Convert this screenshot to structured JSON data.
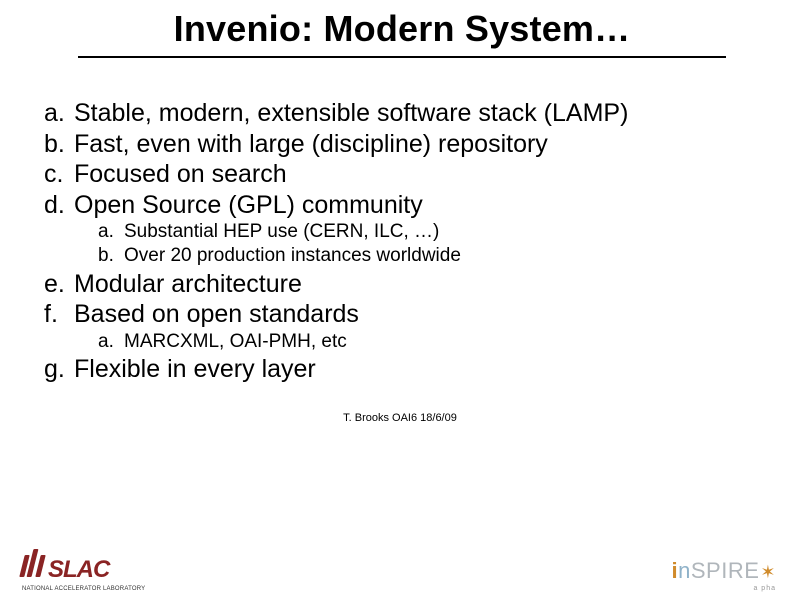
{
  "title": "Invenio: Modern System…",
  "items": {
    "a": {
      "m": "a.",
      "t": "Stable, modern, extensible software stack (LAMP)"
    },
    "b": {
      "m": "b.",
      "t": "Fast, even with large (discipline) repository"
    },
    "c": {
      "m": "c.",
      "t": "Focused on search"
    },
    "d": {
      "m": "d.",
      "t": "Open Source (GPL) community"
    },
    "d_sub": {
      "a": {
        "m": "a.",
        "t": "Substantial HEP use (CERN, ILC, …)"
      },
      "b": {
        "m": "b.",
        "t": "Over 20 production instances worldwide"
      }
    },
    "e": {
      "m": "e.",
      "t": "Modular architecture"
    },
    "f": {
      "m": "f.",
      "t": "Based on open standards"
    },
    "f_sub": {
      "a": {
        "m": "a.",
        "t": "MARCXML, OAI-PMH, etc"
      }
    },
    "g": {
      "m": "g.",
      "t": "Flexible in every layer"
    }
  },
  "credit": "T. Brooks OAI6 18/6/09",
  "footer": {
    "slac_text": "SLAC",
    "slac_sub": "NATIONAL ACCELERATOR LABORATORY",
    "inspire_i": "i",
    "inspire_n": "n",
    "inspire_rest": "SPIRE",
    "inspire_star": "✶",
    "inspire_sub": "a pha"
  }
}
